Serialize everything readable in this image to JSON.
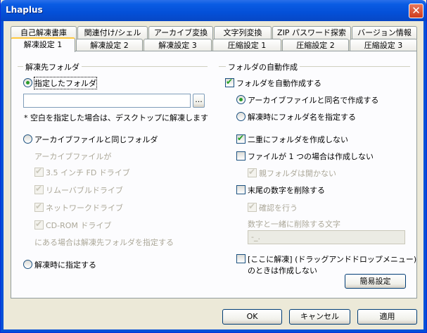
{
  "window": {
    "title": "Lhaplus",
    "close_label": "✕"
  },
  "tabs_row1": [
    "自己解凍書庫",
    "関連付け/シェル",
    "アーカイブ変換",
    "文字列変換",
    "ZIP パスワード探索",
    "バージョン情報"
  ],
  "tabs_row2": [
    "解凍設定 1",
    "解凍設定 2",
    "解凍設定 3",
    "圧縮設定 1",
    "圧縮設定 2",
    "圧縮設定 3"
  ],
  "left": {
    "group_title": "解凍先フォルダ",
    "radio_specified": "指定したフォルダ",
    "path_value": "",
    "browse_label": "...",
    "note": "* 空白を指定した場合は、デスクトップに解凍します",
    "radio_same": "アーカイブファイルと同じフォルダ",
    "archive_if": "アーカイブファイルが",
    "drives": [
      "3.5 インチ FD ドライブ",
      "リムーバブルドライブ",
      "ネットワークドライブ",
      "CD-ROM ドライブ"
    ],
    "drive_note": "にある場合は解凍先フォルダを指定する",
    "radio_ask": "解凍時に指定する"
  },
  "right": {
    "group_title": "フォルダの自動作成",
    "auto_create": "フォルダを自動作成する",
    "same_name": "アーカイブファイルと同名で作成する",
    "ask_name": "解凍時にフォルダ名を指定する",
    "no_double": "二重にフォルダを作成しない",
    "single_file": "ファイルが 1 つの場合は作成しない",
    "no_open_parent": "親フォルダは開かない",
    "del_trailing": "末尾の数字を削除する",
    "confirm": "確認を行う",
    "del_chars_label": "数字と一緒に削除する文字",
    "del_chars_value": "-_.",
    "dnd_line1": "[ここに解凍] (ドラッグアンドドロップメニュー)",
    "dnd_line2": "のときは作成しない",
    "simple_btn": "簡易設定"
  },
  "buttons": {
    "ok": "OK",
    "cancel": "キャンセル",
    "apply": "適用"
  }
}
